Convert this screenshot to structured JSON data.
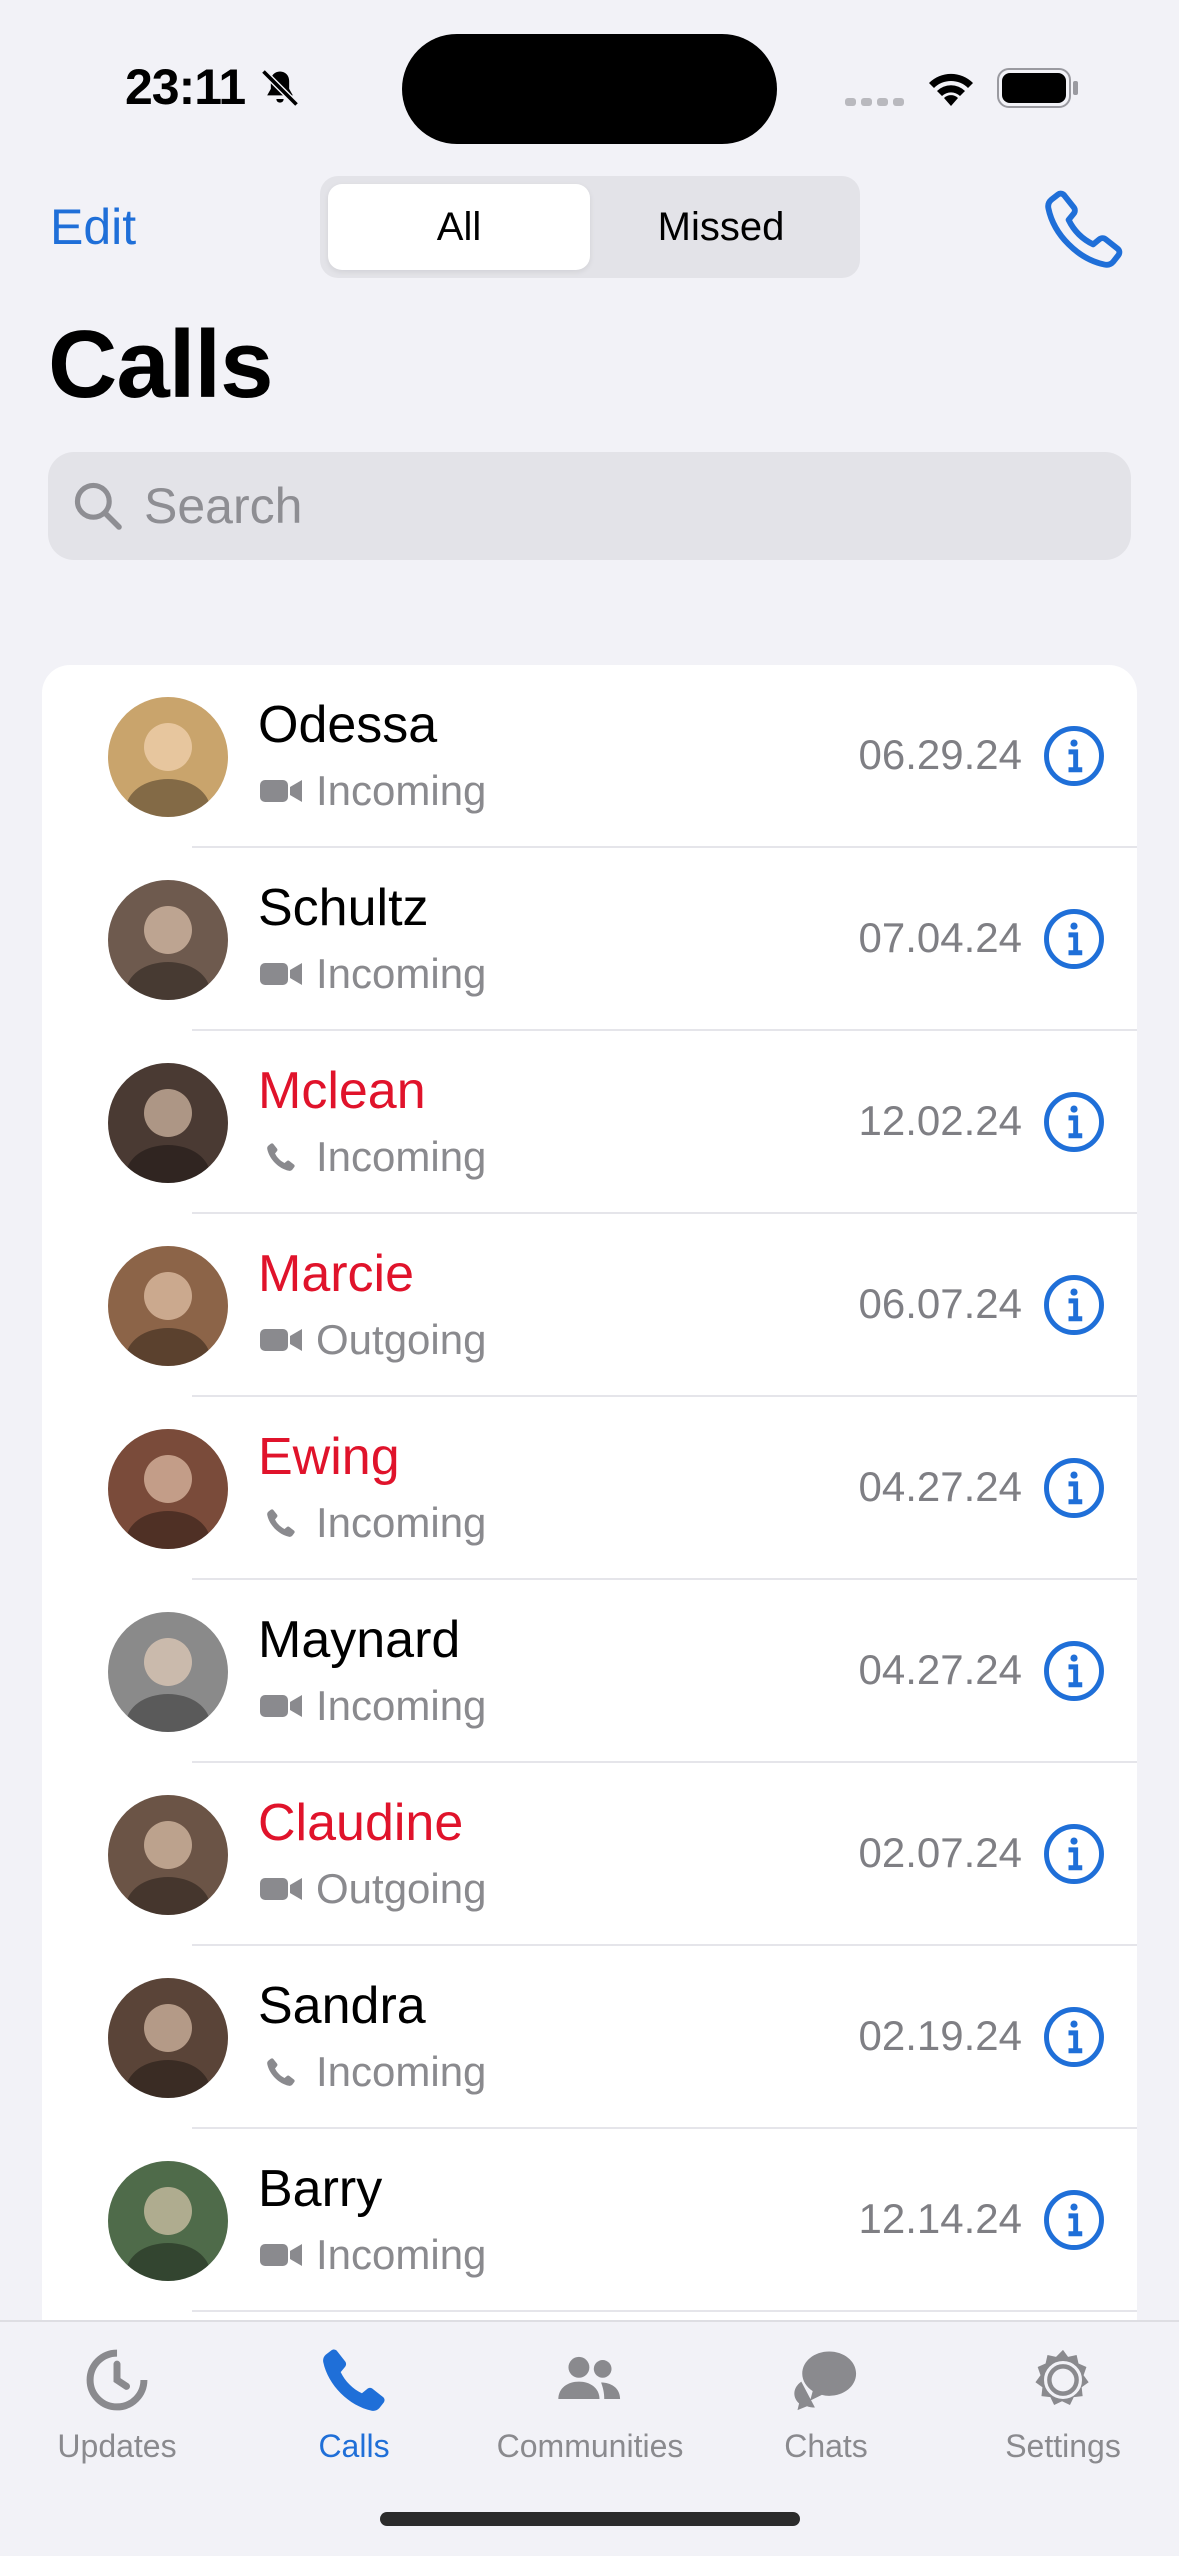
{
  "status_bar": {
    "time": "23:11"
  },
  "header": {
    "edit_label": "Edit",
    "segments": [
      "All",
      "Missed"
    ],
    "title": "Calls",
    "search_placeholder": "Search"
  },
  "calls": [
    {
      "name": "Odessa",
      "type": "video",
      "direction": "Incoming",
      "date": "06.29.24",
      "missed": false,
      "avatar_color": "#c9a46c"
    },
    {
      "name": "Schultz",
      "type": "video",
      "direction": "Incoming",
      "date": "07.04.24",
      "missed": false,
      "avatar_color": "#6e5a4e"
    },
    {
      "name": "Mclean",
      "type": "phone",
      "direction": "Incoming",
      "date": "12.02.24",
      "missed": true,
      "avatar_color": "#4a3a33"
    },
    {
      "name": "Marcie",
      "type": "video",
      "direction": "Outgoing",
      "date": "06.07.24",
      "missed": true,
      "avatar_color": "#8c6448"
    },
    {
      "name": "Ewing",
      "type": "phone",
      "direction": "Incoming",
      "date": "04.27.24",
      "missed": true,
      "avatar_color": "#7a4b3a"
    },
    {
      "name": "Maynard",
      "type": "video",
      "direction": "Incoming",
      "date": "04.27.24",
      "missed": false,
      "avatar_color": "#8a8a8a"
    },
    {
      "name": "Claudine",
      "type": "video",
      "direction": "Outgoing",
      "date": "02.07.24",
      "missed": true,
      "avatar_color": "#6b5446"
    },
    {
      "name": "Sandra",
      "type": "phone",
      "direction": "Incoming",
      "date": "02.19.24",
      "missed": false,
      "avatar_color": "#5a4438"
    },
    {
      "name": "Barry",
      "type": "video",
      "direction": "Incoming",
      "date": "12.14.24",
      "missed": false,
      "avatar_color": "#4f6b4a"
    }
  ],
  "tabs": [
    {
      "label": "Updates",
      "icon": "updates-icon",
      "active": false
    },
    {
      "label": "Calls",
      "icon": "phone-icon",
      "active": true
    },
    {
      "label": "Communities",
      "icon": "communities-icon",
      "active": false
    },
    {
      "label": "Chats",
      "icon": "chats-icon",
      "active": false
    },
    {
      "label": "Settings",
      "icon": "gear-icon",
      "active": false
    }
  ],
  "colors": {
    "accent": "#1f6fd8",
    "missed": "#e0132b",
    "secondary_text": "#8a8a8e"
  }
}
